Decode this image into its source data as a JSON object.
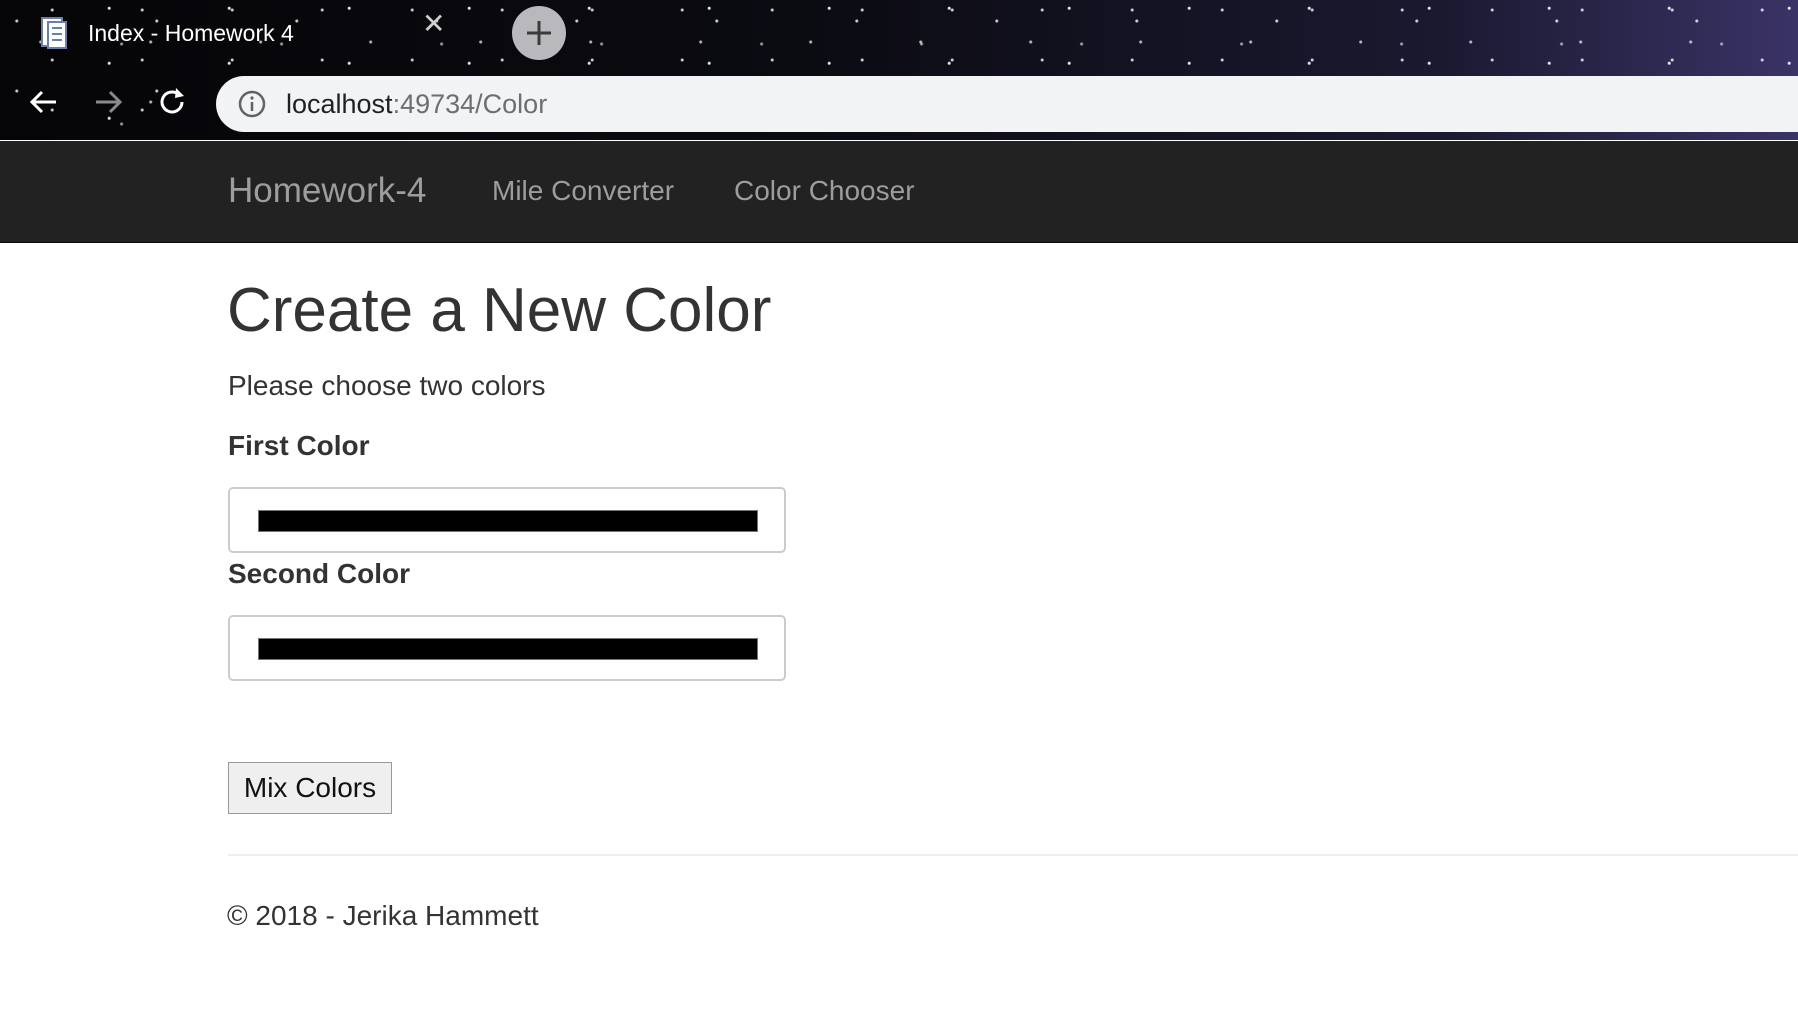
{
  "browser": {
    "tab_title": "Index - Homework 4",
    "tab_close_glyph": "✕",
    "favicon_icon": "document-icon",
    "url_host": "localhost",
    "url_path": ":49734/Color",
    "info_icon": "info-icon",
    "back_icon": "arrow-left-icon",
    "forward_icon": "arrow-right-icon",
    "reload_icon": "reload-icon",
    "new_tab_icon": "plus-icon"
  },
  "navbar": {
    "brand": "Homework-4",
    "links": [
      {
        "label": "Mile Converter"
      },
      {
        "label": "Color Chooser"
      }
    ],
    "background_color": "#222222",
    "link_color": "#9d9d9d"
  },
  "main": {
    "title": "Create a New Color",
    "intro": "Please choose two colors",
    "first_color_label": "First Color",
    "first_color_value": "#000000",
    "second_color_label": "Second Color",
    "second_color_value": "#000000",
    "submit_label": "Mix Colors"
  },
  "footer": {
    "text": "© 2018 - Jerika Hammett"
  }
}
